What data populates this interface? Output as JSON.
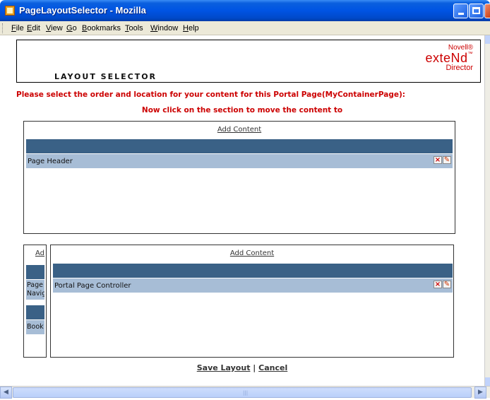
{
  "window": {
    "title": "PageLayoutSelector - Mozilla"
  },
  "menu": {
    "items": [
      "File",
      "Edit",
      "View",
      "Go",
      "Bookmarks",
      "Tools",
      "Window",
      "Help"
    ]
  },
  "header": {
    "title": "LAYOUT SELECTOR",
    "logo": {
      "line1": "Novell®",
      "line2": "exteNd",
      "tm": "™",
      "line3": "Director"
    }
  },
  "instructions": {
    "primary": "Please select the order and location for your content for this Portal Page(MyContainerPage):",
    "secondary": "Now click on the section to move the content to"
  },
  "sections": {
    "top": {
      "add_content": "Add Content",
      "items": [
        "Page Header"
      ]
    },
    "left": {
      "add_content": "Ad",
      "items": [
        "Page Navig",
        "Book"
      ]
    },
    "main": {
      "add_content": "Add Content",
      "items": [
        "Portal Page Controller"
      ]
    }
  },
  "footer": {
    "save": "Save Layout",
    "separator": "|",
    "cancel": "Cancel"
  },
  "colors": {
    "accent_red": "#cc0000",
    "bar_dark": "#3a6186",
    "bar_light": "#a7bdd6"
  },
  "icons": {
    "delete": "close-x-icon",
    "edit": "pencil-icon"
  }
}
